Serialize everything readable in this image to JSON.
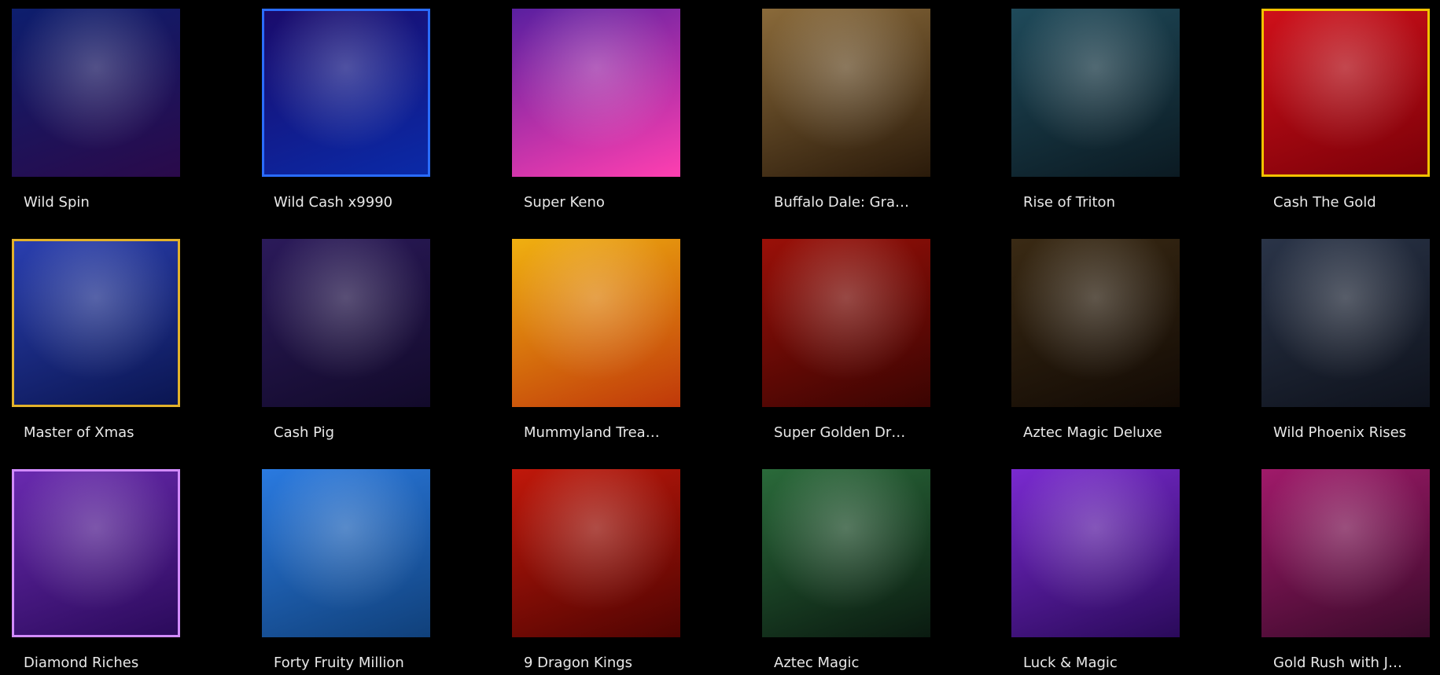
{
  "games": [
    {
      "title": "Wild Spin",
      "art": {
        "logo": "",
        "badge": "",
        "bg": [
          "#0d1e6e",
          "#2a0a4a"
        ],
        "frame": ""
      }
    },
    {
      "title": "Wild Cash x9990",
      "art": {
        "logo": "",
        "badge": "",
        "bg": [
          "#1a0b6b",
          "#0a2aa8"
        ],
        "frame": "#2a6cff"
      }
    },
    {
      "title": "Super Keno",
      "art": {
        "logo": "",
        "badge": "",
        "bg": [
          "#5a1fa0",
          "#ff3fb0"
        ],
        "frame": ""
      }
    },
    {
      "title": "Buffalo Dale: Gra…",
      "art": {
        "logo": "",
        "badge": "",
        "bg": [
          "#8a6a3a",
          "#2a1a0a"
        ],
        "frame": ""
      }
    },
    {
      "title": "Rise of Triton",
      "art": {
        "logo": "",
        "badge": "",
        "bg": [
          "#1f4a5a",
          "#0b1a22"
        ],
        "frame": ""
      }
    },
    {
      "title": "Cash The Gold",
      "art": {
        "logo": "",
        "badge": "",
        "bg": [
          "#d0101a",
          "#7a0008"
        ],
        "frame": "#f2c200"
      }
    },
    {
      "title": "Master of Xmas",
      "art": {
        "logo": "",
        "badge": "",
        "bg": [
          "#2a3fb0",
          "#0a1550"
        ],
        "frame": "#e3b22a"
      }
    },
    {
      "title": "Cash Pig",
      "art": {
        "logo": "",
        "badge": "",
        "bg": [
          "#2b1a5a",
          "#120a2a"
        ],
        "frame": ""
      }
    },
    {
      "title": "Mummyland Trea…",
      "art": {
        "logo": "",
        "badge": "",
        "bg": [
          "#f0b010",
          "#c0380a"
        ],
        "frame": ""
      }
    },
    {
      "title": "Super Golden Dr…",
      "art": {
        "logo": "",
        "badge": "",
        "bg": [
          "#9a1008",
          "#3a0402"
        ],
        "frame": ""
      }
    },
    {
      "title": "Aztec Magic Deluxe",
      "art": {
        "logo": "",
        "badge": "",
        "bg": [
          "#3a2a14",
          "#120a04"
        ],
        "frame": ""
      }
    },
    {
      "title": "Wild Phoenix Rises",
      "art": {
        "logo": "",
        "badge": "",
        "bg": [
          "#2a3448",
          "#0e121c"
        ],
        "frame": ""
      }
    },
    {
      "title": "Diamond Riches",
      "art": {
        "logo": "",
        "badge": "",
        "bg": [
          "#6a2ab0",
          "#2a0a5a"
        ],
        "frame": "#d28bff"
      }
    },
    {
      "title": "Forty Fruity Million",
      "art": {
        "logo": "",
        "badge": "",
        "bg": [
          "#2a7ae0",
          "#10407a"
        ],
        "frame": ""
      }
    },
    {
      "title": "9 Dragon Kings",
      "art": {
        "logo": "",
        "badge": "",
        "bg": [
          "#c0180a",
          "#500402"
        ],
        "frame": ""
      }
    },
    {
      "title": "Aztec Magic",
      "art": {
        "logo": "",
        "badge": "",
        "bg": [
          "#2a6a3a",
          "#0a1a10"
        ],
        "frame": ""
      }
    },
    {
      "title": "Luck & Magic",
      "art": {
        "logo": "",
        "badge": "",
        "bg": [
          "#7a2ad0",
          "#2a0a5a"
        ],
        "frame": ""
      }
    },
    {
      "title": "Gold Rush with J…",
      "art": {
        "logo": "",
        "badge": "",
        "bg": [
          "#a01a6a",
          "#3a0a2a"
        ],
        "frame": ""
      }
    }
  ]
}
